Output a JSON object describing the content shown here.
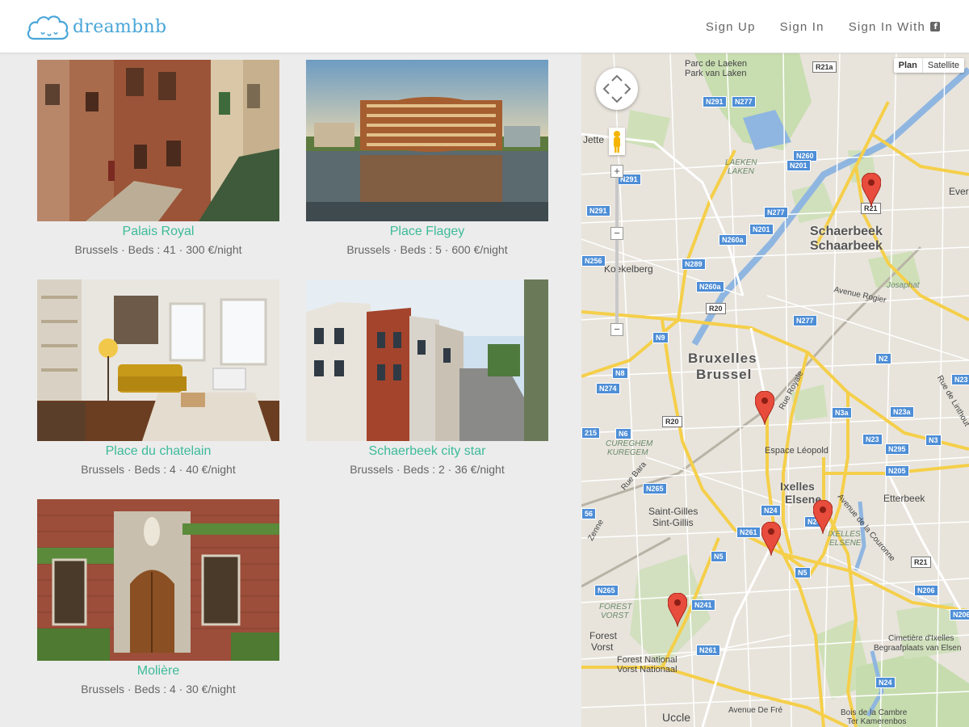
{
  "header": {
    "brand": "dreambnb",
    "nav": {
      "sign_up": "Sign Up",
      "sign_in": "Sign In",
      "sign_in_with": "Sign In With",
      "facebook_icon_glyph": "f"
    }
  },
  "listings": [
    {
      "name": "Palais Royal",
      "meta": "Brussels · Beds : 41 · 300 €/night"
    },
    {
      "name": "Place Flagey",
      "meta": "Brussels · Beds : 5 · 600 €/night"
    },
    {
      "name": "Place du chatelain",
      "meta": "Brussels · Beds : 4 · 40 €/night"
    },
    {
      "name": "Schaerbeek city star",
      "meta": "Brussels · Beds : 2 · 36 €/night"
    },
    {
      "name": "Molière",
      "meta": "Brussels · Beds : 4 · 30 €/night"
    }
  ],
  "map": {
    "type_plan": "Plan",
    "type_satellite": "Satellite",
    "zoom_in": "+",
    "zoom_mid": "−",
    "zoom_out": "−",
    "labels": {
      "parc_de_laeken": "Parc de Laeken",
      "park_van_laken": "Park van Laken",
      "jette": "Jette",
      "laeken": "LAEKEN",
      "laken": "LAKEN",
      "ever": "Ever",
      "schaerbeek": "Schaerbeek",
      "schaarbeek": "Schaarbeek",
      "koekelberg": "Koekelberg",
      "josaphat": "Josaphat",
      "avenue_rogier": "Avenue Rogier",
      "bruxelles": "Bruxelles",
      "brussel": "Brussel",
      "rue_royale": "Rue Royale",
      "rue_de_linthout": "Rue de Linthout",
      "cureghem": "CUREGHEM",
      "kuregem": "KUREGEM",
      "espace_leopold": "Espace Léopold",
      "rue_bara": "Rue Bara",
      "ixelles": "Ixelles",
      "elsene": "Elsene",
      "etterbeek": "Etterbeek",
      "saint_gilles": "Saint-Gilles",
      "sint_gillis": "Sint-Gillis",
      "ixelles_small": "IXELLES",
      "elsene_small": "ELSENE",
      "avenue_couronne": "Avenue de la Couronne",
      "zenne": "Zenne",
      "forest_small": "FOREST",
      "vorst_small": "VORST",
      "forest": "Forest",
      "vorst": "Vorst",
      "forest_national": "Forest National",
      "vorst_nationaal": "Vorst Nationaal",
      "cimetiere": "Cimetière d'Ixelles",
      "begraafplaats": "Begraafplaats van Elsen",
      "avenue_de_fre": "Avenue De Fré",
      "uccle": "Uccle",
      "bois_de_la_cambre": "Bois de la Cambre",
      "ter_kamerenbos": "Ter Kamerenbos"
    },
    "roads": {
      "r21a": "R21a",
      "n291a": "N291",
      "n277a": "N277",
      "n260": "N260",
      "n201a": "N201",
      "n291b": "N291",
      "n291c": "N291",
      "r21b": "R21",
      "n277b": "N277",
      "n201b": "N201",
      "n260a_a": "N260a",
      "n256": "N256",
      "n289": "N289",
      "n260a_b": "N260a",
      "r20a": "R20",
      "n277c": "N277",
      "n9": "N9",
      "n2": "N2",
      "n8": "N8",
      "n274": "N274",
      "n23": "N23",
      "n3a": "N3a",
      "n23a": "N23a",
      "r20b": "R20",
      "n6": "N6",
      "n23b": "N23",
      "n3": "N3",
      "n295": "N295",
      "n215": "215",
      "n205": "N205",
      "n265a": "N265",
      "n24a": "N24",
      "n261a": "N261",
      "n24b": "N24",
      "n5": "N5",
      "r21c": "R21",
      "n56": "56",
      "n265b": "N265",
      "n241": "N241",
      "n206a": "N206",
      "n206b": "N206",
      "n261b": "N261",
      "n24c": "N24"
    }
  }
}
